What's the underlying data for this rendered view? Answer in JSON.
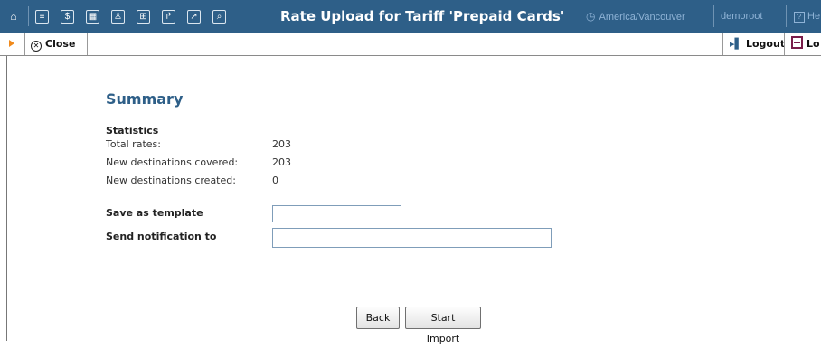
{
  "window_title": "Rate Upload for Tariff 'Prepaid Cards'",
  "topbar": {
    "icons": [
      "home-icon",
      "list-icon",
      "dollar-icon",
      "grid-icon",
      "person-icon",
      "network-icon",
      "transfer-icon",
      "chart-icon",
      "search-icon"
    ],
    "timezone": "America/Vancouver",
    "user": "demoroot",
    "help": "He"
  },
  "toolbar": {
    "close_label": "Close",
    "logout_label": "Logout",
    "logoff_label": "Lo"
  },
  "summary": {
    "heading": "Summary",
    "statistics_title": "Statistics",
    "stats": [
      {
        "label": "Total rates:",
        "value": "203"
      },
      {
        "label": "New destinations covered:",
        "value": "203"
      },
      {
        "label": "New destinations created:",
        "value": "0"
      }
    ]
  },
  "form": {
    "save_template_label": "Save as template",
    "save_template_value": "",
    "notification_label": "Send notification to",
    "notification_value": ""
  },
  "buttons": {
    "back": "Back",
    "start_import": "Start Import"
  },
  "colors": {
    "topbar_bg": "#2e5f88",
    "heading": "#2e5f88",
    "accent": "#f08a1c"
  }
}
